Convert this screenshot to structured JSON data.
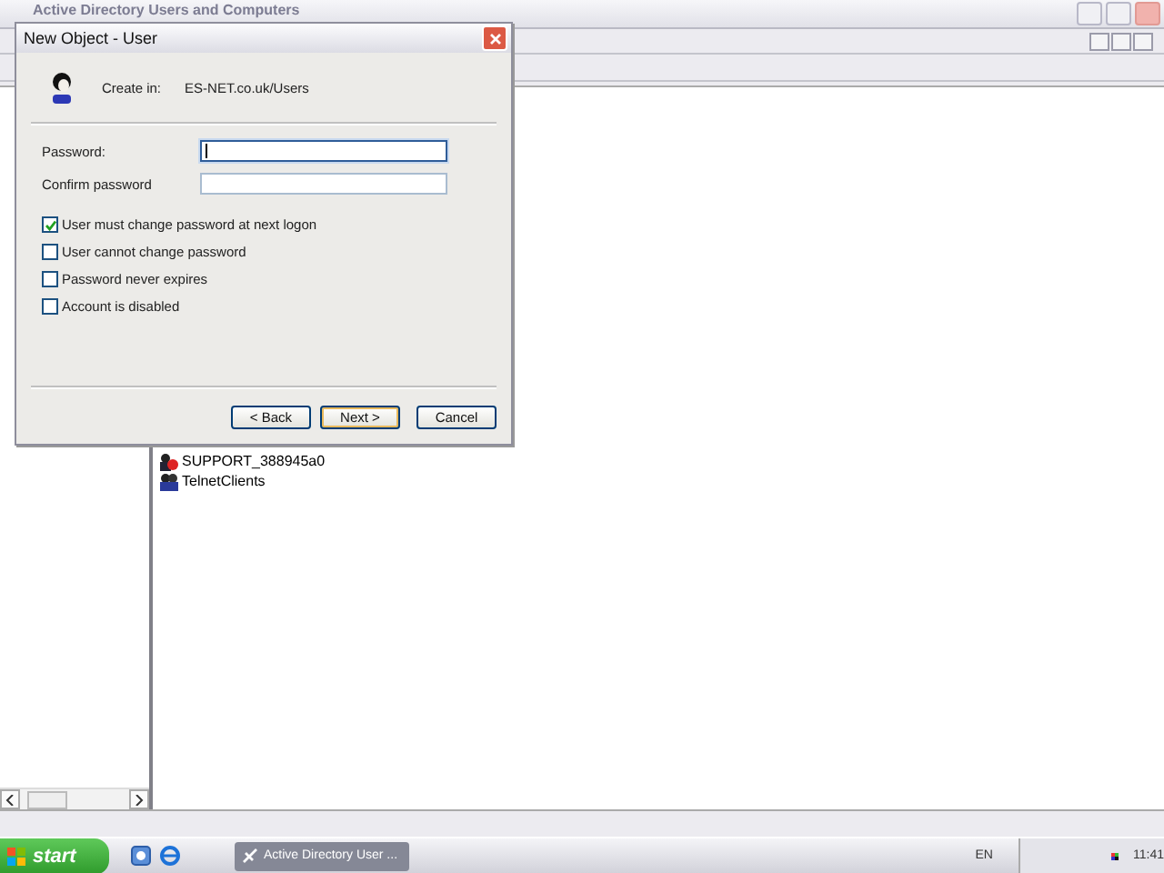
{
  "main_window": {
    "title": "Active Directory Users and Computers"
  },
  "list_items": [
    {
      "label": "SUPPORT_388945a0",
      "kind": "user"
    },
    {
      "label": "TelnetClients",
      "kind": "group"
    }
  ],
  "dialog": {
    "title": "New Object - User",
    "create_in_label": "Create in:",
    "create_in_path": "ES-NET.co.uk/Users",
    "fields": [
      {
        "label": "Password:",
        "focused": true
      },
      {
        "label": "Confirm password",
        "focused": false
      }
    ],
    "checkboxes": [
      {
        "label": "User must change password at next logon",
        "checked": true
      },
      {
        "label": "User cannot change password",
        "checked": false
      },
      {
        "label": "Password never expires",
        "checked": false
      },
      {
        "label": "Account is disabled",
        "checked": false
      }
    ],
    "buttons": [
      {
        "label": "< Back",
        "default": false
      },
      {
        "label": "Next >",
        "default": true
      },
      {
        "label": "Cancel",
        "default": false
      }
    ]
  },
  "taskbar": {
    "start": "start",
    "task": "Active Directory User ...",
    "language": "EN",
    "clock": "11:41"
  }
}
